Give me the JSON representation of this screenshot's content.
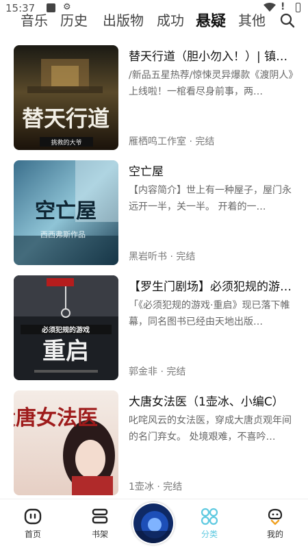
{
  "status_bar": {
    "time": "15:37"
  },
  "tabs": [
    {
      "label": "音乐"
    },
    {
      "label": "历史"
    },
    {
      "label": "出版物"
    },
    {
      "label": "成功"
    },
    {
      "label": "悬疑",
      "active": true
    },
    {
      "label": "其他"
    }
  ],
  "books": [
    {
      "title": "替天行道（胆小勿入！）| 镇…",
      "description": "/新品五星热荐/惊悚灵异爆款《渡阴人》上线啦！一棺看尽身前事，两…",
      "meta": "雁栖鸣工作室 · 完结",
      "cover_text": "替天行道",
      "cover_sub": "挑救的大爷"
    },
    {
      "title": "空亡屋",
      "description": "【内容简介】世上有一种屋子，屋门永远开一半，关一半。 开着的一…",
      "meta": "黑岩听书 · 完结",
      "cover_text": "空亡屋",
      "cover_sub": "西西弗斯作品"
    },
    {
      "title": "【罗生门剧场】必须犯规的游…",
      "description": "「《必须犯规的游戏·重启》现已落下帷幕，同名图书已经由天地出版…",
      "meta": "郭金非 · 完结",
      "cover_text": "重启",
      "cover_sub": "必须犯规的游戏"
    },
    {
      "title": "大唐女法医（1壶冰、小编C）",
      "description": "叱咤风云的女法医，穿成大唐贞观年间的名门弃女。 处境艰难，不喜吟…",
      "meta": "1壶冰 · 完结",
      "cover_text": "大唐女法医",
      "cover_sub": ""
    }
  ],
  "bottom_nav": [
    {
      "label": "首页",
      "icon": "home-icon"
    },
    {
      "label": "书架",
      "icon": "bookshelf-icon"
    },
    {
      "label": "",
      "icon": "now-playing-cover"
    },
    {
      "label": "分类",
      "icon": "category-icon",
      "active": true
    },
    {
      "label": "我的",
      "icon": "profile-icon"
    }
  ],
  "colors": {
    "accent": "#5dc9e0"
  }
}
